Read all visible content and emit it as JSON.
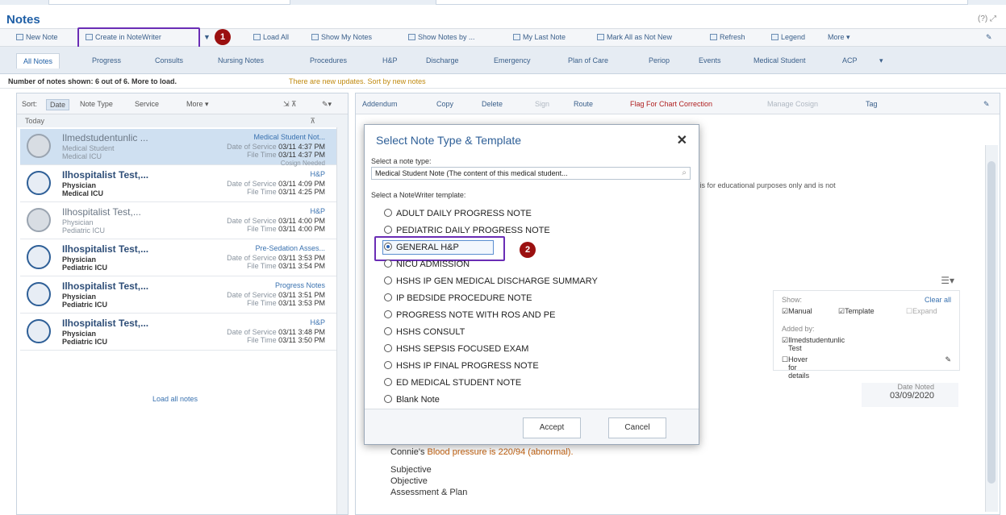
{
  "app": {
    "title": "Notes",
    "help_icons": "(?) ⤢"
  },
  "toolbar": {
    "new_note": "New Note",
    "create_notewriter": "Create in NoteWriter",
    "load_all": "Load All",
    "show_my_notes": "Show My Notes",
    "show_notes_by": "Show Notes by ...",
    "my_last_note": "My Last Note",
    "mark_all": "Mark All as Not New",
    "refresh": "Refresh",
    "legend": "Legend",
    "more": "More ▾"
  },
  "annotations": {
    "step1": "1",
    "step2": "2"
  },
  "tabs": [
    "All Notes",
    "Progress",
    "Consults",
    "Nursing Notes",
    "Procedures",
    "H&P",
    "Discharge",
    "Emergency",
    "Plan of Care",
    "Periop",
    "Events",
    "Medical Student",
    "ACP",
    "▾"
  ],
  "info": {
    "count": "Number of notes shown: 6 out of 6. More to load.",
    "updates": "There are new updates. Sort by new notes"
  },
  "sortbar": {
    "sort": "Sort:",
    "date": "Date",
    "note_type": "Note Type",
    "service": "Service",
    "more": "More ▾"
  },
  "list": {
    "today": "Today",
    "notes": [
      {
        "name": "Ilmedstudentunlic ...",
        "role": "Medical Student",
        "unit": "Medical ICU",
        "type": "Medical Student Not...",
        "dos_label": "Date of Service",
        "dos": "03/11 4:37 PM",
        "ft_label": "File Time",
        "ft": "03/11 4:37 PM",
        "extra": "Cosign Needed"
      },
      {
        "name": "Ilhospitalist Test,...",
        "role": "Physician",
        "unit": "Medical ICU",
        "type": "H&P",
        "dos_label": "Date of Service",
        "dos": "03/11 4:09 PM",
        "ft_label": "File Time",
        "ft": "03/11 4:25 PM",
        "extra": ""
      },
      {
        "name": "Ilhospitalist Test,...",
        "role": "Physician",
        "unit": "Pediatric ICU",
        "type": "H&P",
        "dos_label": "Date of Service",
        "dos": "03/11 4:00 PM",
        "ft_label": "File Time",
        "ft": "03/11 4:00 PM",
        "extra": ""
      },
      {
        "name": "Ilhospitalist Test,...",
        "role": "Physician",
        "unit": "Pediatric ICU",
        "type": "Pre-Sedation Asses...",
        "dos_label": "Date of Service",
        "dos": "03/11 3:53 PM",
        "ft_label": "File Time",
        "ft": "03/11 3:54 PM",
        "extra": ""
      },
      {
        "name": "Ilhospitalist Test,...",
        "role": "Physician",
        "unit": "Pediatric ICU",
        "type": "Progress Notes",
        "dos_label": "Date of Service",
        "dos": "03/11 3:51 PM",
        "ft_label": "File Time",
        "ft": "03/11 3:53 PM",
        "extra": ""
      },
      {
        "name": "Ilhospitalist Test,...",
        "role": "Physician",
        "unit": "Pediatric ICU",
        "type": "H&P",
        "dos_label": "Date of Service",
        "dos": "03/11 3:48 PM",
        "ft_label": "File Time",
        "ft": "03/11 3:50 PM",
        "extra": ""
      }
    ],
    "load_all": "Load all notes"
  },
  "right_toolbar": {
    "addendum": "Addendum",
    "copy": "Copy",
    "delete": "Delete",
    "sign": "Sign",
    "route": "Route",
    "flag": "Flag For Chart Correction",
    "manage_cosign": "Manage Cosign",
    "tag": "Tag"
  },
  "right_content": {
    "edu_text": "e is for educational purposes only and is not",
    "show_label": "Show:",
    "clear_all": "Clear all",
    "manual": "Manual",
    "template": "Template",
    "expand": "Expand",
    "added_by": "Added by:",
    "added_by_user": "Ilmedstudentunlic Test",
    "hover": "Hover for details",
    "date_noted_label": "Date Noted",
    "date_noted": "03/09/2020",
    "bp_prefix": "Connie's",
    "bp_text": "Blood pressure is 220/94 (abnormal).",
    "subjective": "Subjective",
    "objective": "Objective",
    "assessment": "Assessment & Plan"
  },
  "modal": {
    "title": "Select Note Type & Template",
    "close": "✕",
    "note_type_label": "Select a note type:",
    "note_type_value": "Medical Student Note (The content of this medical student...",
    "template_label": "Select a NoteWriter template:",
    "options": [
      "ADULT DAILY PROGRESS NOTE",
      "PEDIATRIC DAILY PROGRESS NOTE",
      "GENERAL H&P",
      "NICU ADMISSION",
      "HSHS IP GEN MEDICAL DISCHARGE SUMMARY",
      "IP BEDSIDE PROCEDURE NOTE",
      "PROGRESS NOTE WITH ROS AND PE",
      "HSHS CONSULT",
      "HSHS SEPSIS FOCUSED EXAM",
      "HSHS IP FINAL PROGRESS NOTE",
      "ED MEDICAL STUDENT NOTE",
      "Blank Note"
    ],
    "selected_index": 2,
    "accept": "Accept",
    "cancel": "Cancel"
  }
}
